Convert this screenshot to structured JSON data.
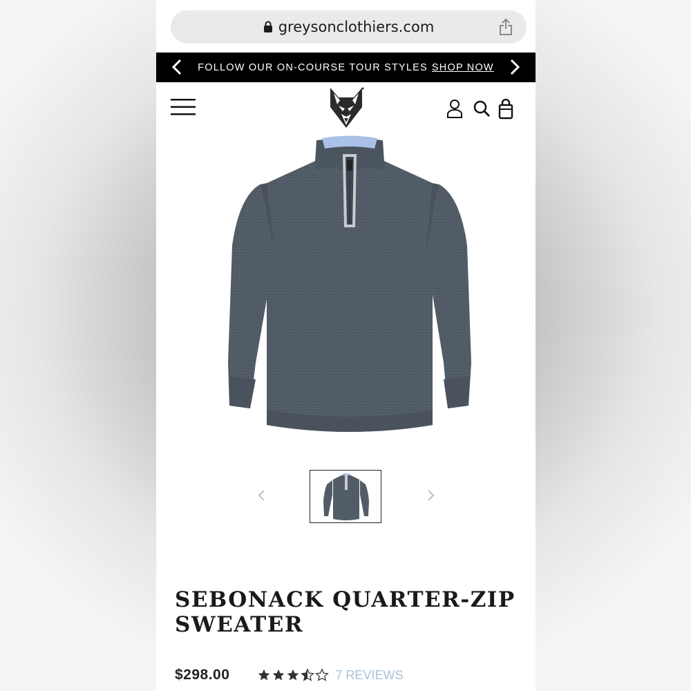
{
  "browser": {
    "url": "greysonclothiers.com",
    "lock_icon": "lock-icon",
    "share_icon": "share-icon"
  },
  "promo_banner": {
    "text": "FOLLOW OUR ON-COURSE TOUR STYLES",
    "link": "SHOP NOW",
    "background": "#000000",
    "color": "#ffffff"
  },
  "header": {
    "menu_icon": "hamburger-menu-icon",
    "logo": "wolf-logo",
    "account_icon": "account-icon",
    "search_icon": "search-icon",
    "bag_icon": "shopping-bag-icon"
  },
  "product": {
    "title": "SEBONACK QUARTER-ZIP SWEATER",
    "price": "$298.00",
    "rating": 3.5,
    "rating_max": 5,
    "reviews": "7 REVIEWS",
    "main_color": "#4e5863",
    "collar_accent": "#a9c1e6",
    "review_link_color": "#aac1d6"
  },
  "gallery": {
    "thumbnail_count": 1,
    "selected_index": 0
  }
}
